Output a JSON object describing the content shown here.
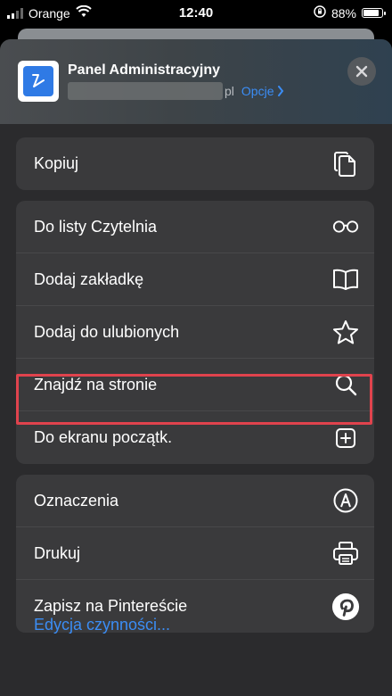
{
  "status_bar": {
    "carrier": "Orange",
    "time": "12:40",
    "battery_percent": "88%",
    "battery_level": 0.88,
    "signal_icon": "signal-bars-icon",
    "wifi_icon": "wifi-icon",
    "orientation_lock_icon": "orientation-lock-icon"
  },
  "header": {
    "site_title": "Panel Administracyjny",
    "url_suffix": "pl",
    "options_label": "Opcje",
    "close_icon": "close-icon"
  },
  "groups": [
    {
      "items": [
        {
          "label": "Kopiuj",
          "icon": "copy-icon"
        }
      ]
    },
    {
      "items": [
        {
          "label": "Do listy Czytelnia",
          "icon": "glasses-icon"
        },
        {
          "label": "Dodaj zakładkę",
          "icon": "book-icon"
        },
        {
          "label": "Dodaj do ulubionych",
          "icon": "star-icon"
        },
        {
          "label": "Znajdź na stronie",
          "icon": "search-icon"
        },
        {
          "label": "Do ekranu początk.",
          "icon": "add-square-icon"
        }
      ]
    },
    {
      "items": [
        {
          "label": "Oznaczenia",
          "icon": "markup-pen-icon"
        },
        {
          "label": "Drukuj",
          "icon": "printer-icon"
        },
        {
          "label": "Zapisz na Pintereście",
          "icon": "pinterest-icon"
        }
      ]
    }
  ],
  "footer": {
    "edit_actions_label": "Edycja czynności..."
  },
  "colors": {
    "accent": "#3b8df5",
    "highlight": "#e0434d",
    "sheet_bg": "#2b2b2d",
    "row_bg": "#3a3a3c"
  }
}
